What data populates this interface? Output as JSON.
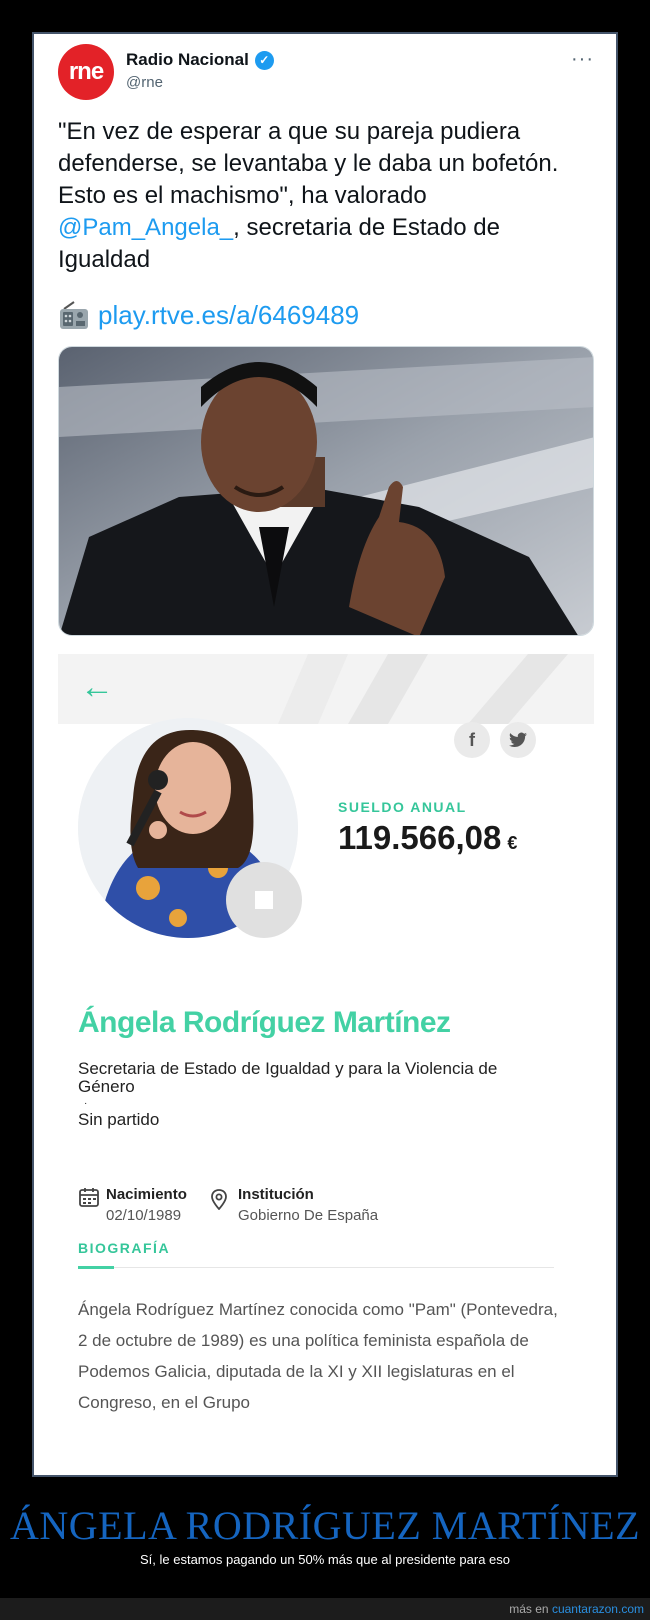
{
  "tweet": {
    "author_name": "Radio Nacional",
    "avatar_text": "rne",
    "handle": "@rne",
    "more_label": "···",
    "text_part1": "\"En vez de esperar a que su pareja pudiera defenderse, se levantaba y le daba un bofetón. Esto es el machismo\", ha valorado ",
    "mention": "@Pam_Angela_",
    "text_part2": ", secretaria de Estado de Igualdad",
    "link": "play.rtve.es/a/6469489"
  },
  "profile": {
    "back_arrow": "←",
    "facebook": "f",
    "twitter": "t",
    "salary_label": "SUELDO ANUAL",
    "salary_value": "119.566,08",
    "salary_currency": "€",
    "name": "Ángela Rodríguez Martínez",
    "role": "Secretaria de Estado de Igualdad y para la Violencia de Género",
    "separator": "·",
    "party": "Sin partido",
    "birth_label": "Nacimiento",
    "birth_value": "02/10/1989",
    "institution_label": "Institución",
    "institution_value": "Gobierno De España",
    "bio_title": "BIOGRAFÍA",
    "bio_text": "Ángela Rodríguez Martínez conocida como \"Pam\" (Pontevedra, 2 de octubre de 1989) es una política feminista española de Podemos Galicia, diputada de la XI y XII legislaturas en el Congreso, en el Grupo"
  },
  "caption": {
    "title": "ÁNGELA RODRÍGUEZ MARTÍNEZ",
    "subtitle": "Sí, le estamos pagando un 50% más que al presidente para eso"
  },
  "footer": {
    "prefix": "más en",
    "site": "cuantarazon.com"
  },
  "colors": {
    "rne_red": "#e32228",
    "twitter_blue": "#1d9bf0",
    "accent_green": "#43d1a4",
    "caption_blue": "#1565c0"
  }
}
